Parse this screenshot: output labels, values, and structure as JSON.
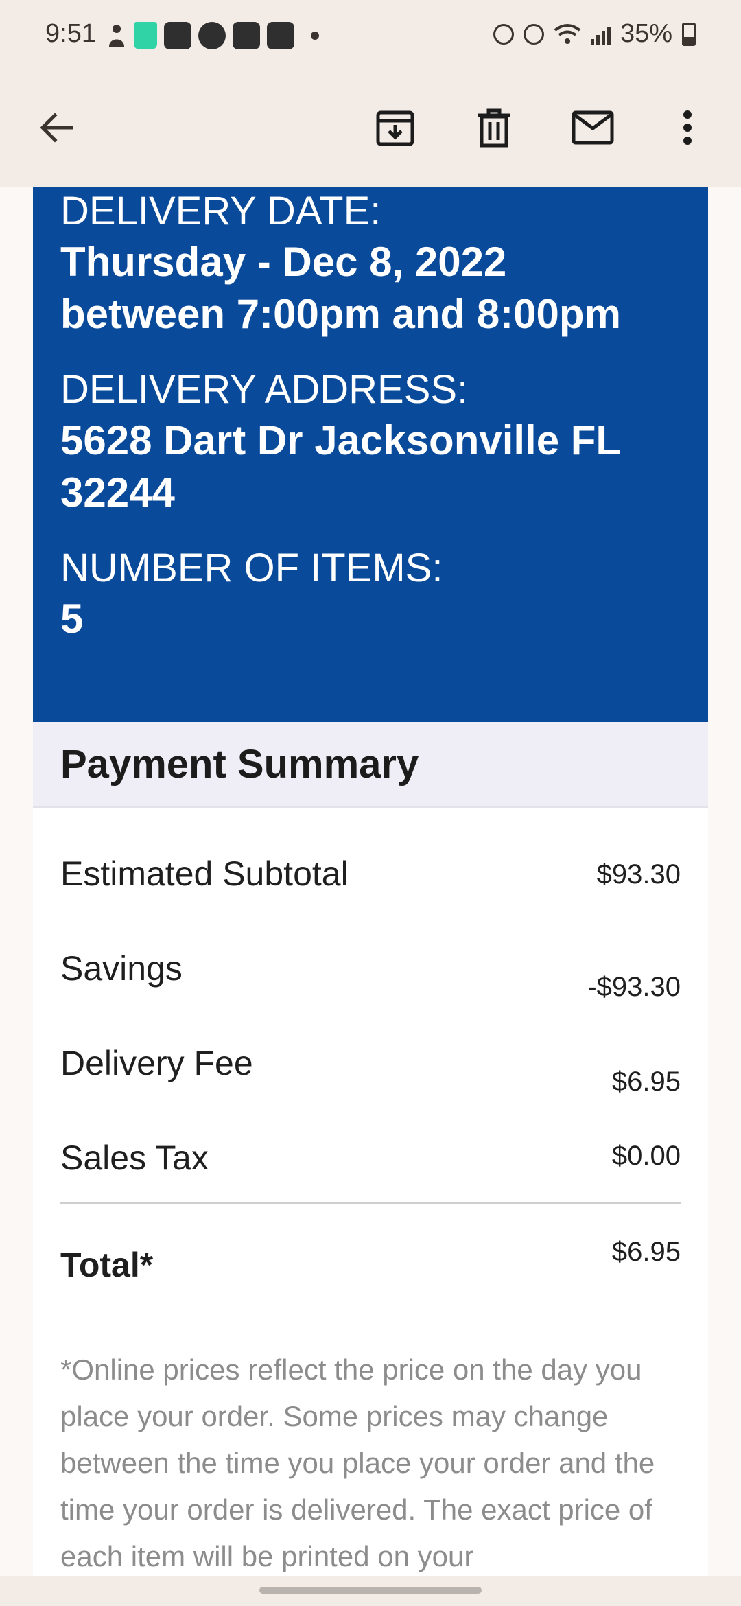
{
  "status_bar": {
    "time": "9:51",
    "battery": "35%",
    "battery_level": 0.35
  },
  "app_bar": {
    "icons": [
      "back-arrow-icon",
      "archive-icon",
      "delete-icon",
      "mail-icon",
      "more-vert-icon"
    ]
  },
  "delivery": {
    "date_label": "DELIVERY DATE:",
    "date_value": "Thursday - Dec 8, 2022",
    "time_value": "between 7:00pm and 8:00pm",
    "address_label": "DELIVERY ADDRESS:",
    "address_line1": "5628 Dart Dr Jacksonville FL",
    "address_line2": "32244",
    "items_label": "NUMBER OF ITEMS:",
    "items_value": "5"
  },
  "payment": {
    "title": "Payment Summary",
    "rows": [
      {
        "label": "Estimated Subtotal",
        "amount": "$93.30"
      },
      {
        "label": "Savings",
        "amount": "-$93.30"
      },
      {
        "label": "Delivery Fee",
        "amount": "$6.95"
      },
      {
        "label": "Sales Tax",
        "amount": "$0.00"
      }
    ],
    "total_label": "Total*",
    "total_amount": "$6.95",
    "note": "*Online prices reflect the price on the day you place your order. Some prices may change between the time you place your order and the time your order is delivered. The exact price of each item will be printed on your"
  },
  "colors": {
    "banner_blue": "#0a4a9a",
    "header_bg": "#f3ece6",
    "summary_header_bg": "#efeef6",
    "note_text": "#8c8c8c"
  }
}
